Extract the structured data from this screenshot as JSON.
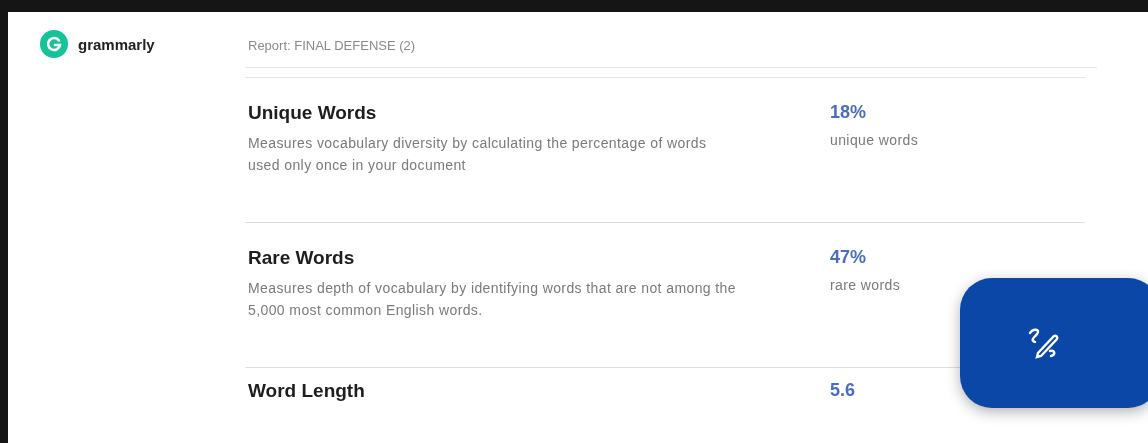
{
  "brand": {
    "name": "grammarly"
  },
  "header": {
    "title": "Report: FINAL DEFENSE (2)"
  },
  "metrics": [
    {
      "title": "Unique Words",
      "description": "Measures vocabulary diversity by calculating the percentage of words used only once in your document",
      "value": "18%",
      "unit": "unique words"
    },
    {
      "title": "Rare Words",
      "description": "Measures depth of vocabulary by identifying words that are not among the 5,000 most common English words.",
      "value": "47%",
      "unit": "rare words"
    },
    {
      "title": "Word Length",
      "value": "5.6"
    }
  ],
  "fab": {
    "kind": "write"
  }
}
